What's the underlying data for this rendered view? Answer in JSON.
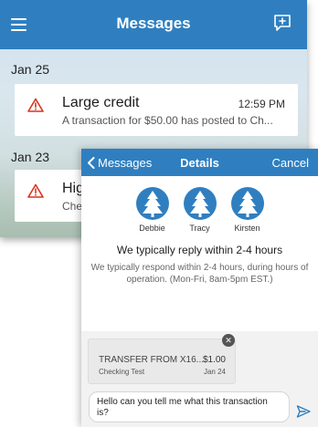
{
  "inbox": {
    "title": "Messages",
    "groups": [
      {
        "date": "Jan 25",
        "message": {
          "title": "Large credit",
          "time": "12:59 PM",
          "preview": "A transaction for $50.00 has posted to Ch..."
        }
      },
      {
        "date": "Jan 23",
        "message": {
          "title": "Hig",
          "preview": "Che"
        }
      }
    ]
  },
  "details": {
    "back_label": "Messages",
    "title": "Details",
    "cancel_label": "Cancel",
    "agents": [
      {
        "name": "Debbie"
      },
      {
        "name": "Tracy"
      },
      {
        "name": "Kirsten"
      }
    ],
    "reply_heading": "We typically reply within 2-4 hours",
    "reply_subtext": "We typically respond within 2-4 hours, during hours of operation. (Mon-Fri, 8am-5pm EST.)",
    "attachment": {
      "name": "TRANSFER FROM X16...",
      "amount": "$1.00",
      "account": "Checking Test",
      "date": "Jan 24"
    },
    "compose_text": "Hello can you tell me what this transaction is?"
  },
  "colors": {
    "brand_blue": "#2f7fc0",
    "warning_red": "#d9341f"
  },
  "icons": {
    "menu": "hamburger-icon",
    "compose": "new-message-icon",
    "alert": "warning-icon",
    "back": "chevron-left-icon",
    "avatar": "pine-tree-icon",
    "remove": "close-icon",
    "send": "send-icon"
  }
}
